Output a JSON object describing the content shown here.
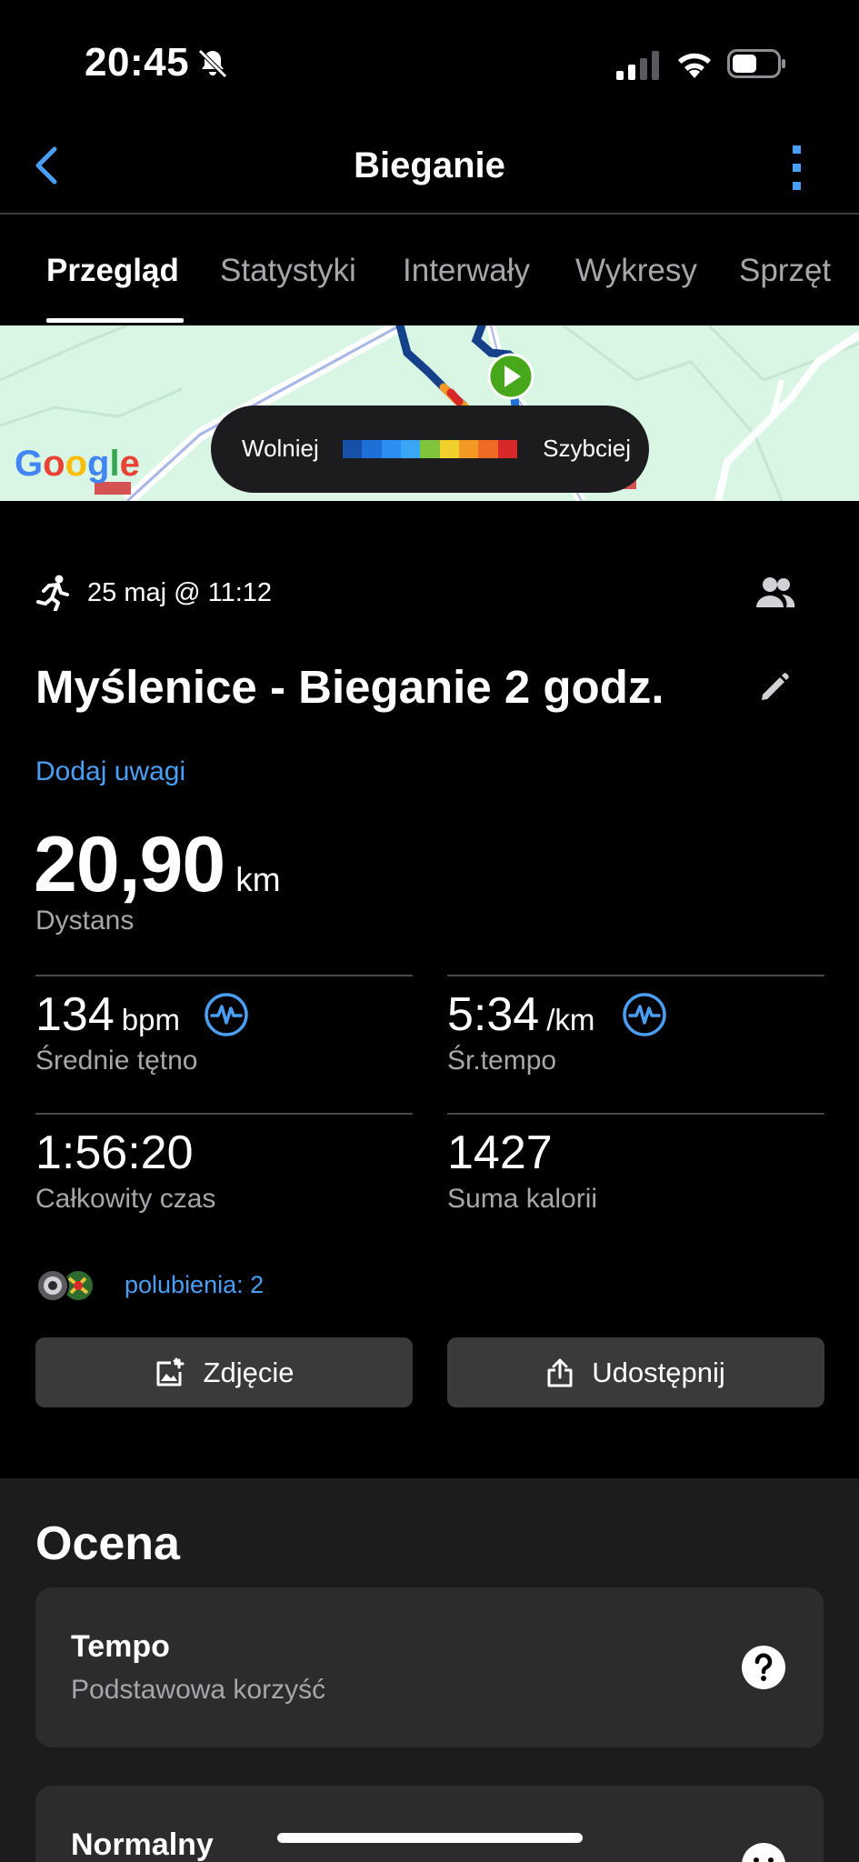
{
  "status_bar": {
    "time": "20:45"
  },
  "nav": {
    "title": "Bieganie"
  },
  "tabs": [
    {
      "label": "Przegląd",
      "active": true
    },
    {
      "label": "Statystyki",
      "active": false
    },
    {
      "label": "Interwały",
      "active": false
    },
    {
      "label": "Wykresy",
      "active": false
    },
    {
      "label": "Sprzęt",
      "active": false
    }
  ],
  "map": {
    "legend_slow": "Wolniej",
    "legend_fast": "Szybciej",
    "legend_colors": [
      "#1650a8",
      "#1e6fd6",
      "#2b8ef0",
      "#3aa7f5",
      "#7fc43a",
      "#f2d02c",
      "#f39a24",
      "#ef6a22",
      "#d7282a"
    ],
    "attribution": "Google"
  },
  "activity": {
    "date": "25 maj @ 11:12",
    "title": "Myślenice - Bieganie 2 godz.",
    "add_notes": "Dodaj uwagi",
    "distance_value": "20,90",
    "distance_unit": "km",
    "distance_label": "Dystans"
  },
  "stats": {
    "heart_rate": {
      "value": "134",
      "unit": "bpm",
      "label": "Średnie tętno"
    },
    "pace": {
      "value": "5:34",
      "unit": "/km",
      "label": "Śr.tempo"
    },
    "total_time": {
      "value": "1:56:20",
      "label": "Całkowity czas"
    },
    "calories": {
      "value": "1427",
      "label": "Suma kalorii"
    }
  },
  "social": {
    "likes": "polubienia: 2"
  },
  "actions": {
    "photo": "Zdjęcie",
    "share": "Udostępnij"
  },
  "rating": {
    "heading": "Ocena",
    "cards": [
      {
        "title": "Tempo",
        "subtitle": "Podstawowa korzyść"
      },
      {
        "title": "Normalny"
      }
    ]
  },
  "colors": {
    "accent": "#4a9ff5",
    "background": "#000000",
    "card": "#2c2c2e"
  }
}
